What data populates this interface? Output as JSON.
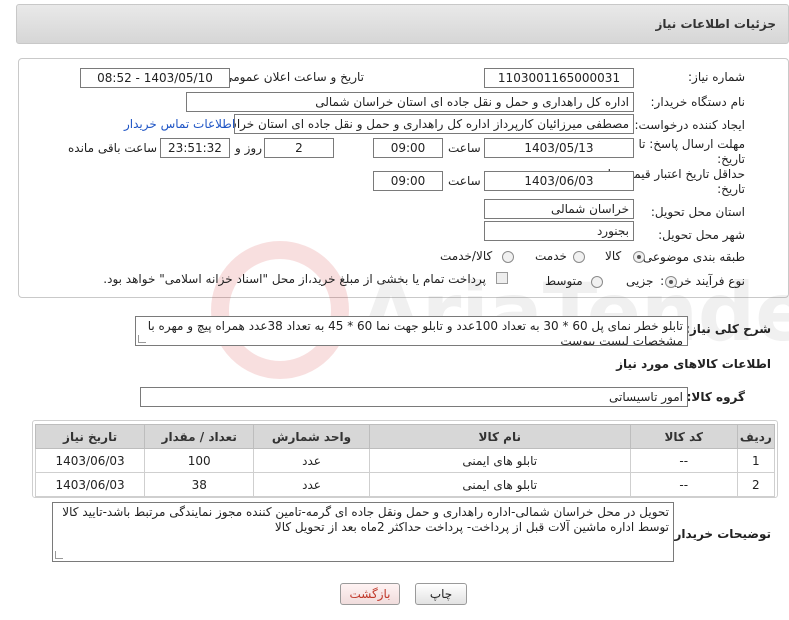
{
  "header": {
    "title": "جزئیات اطلاعات نیاز"
  },
  "form": {
    "need_number": {
      "label": "شماره نیاز:",
      "value": "1103001165000031"
    },
    "announce_datetime": {
      "label": "تاریخ و ساعت اعلان عمومی:",
      "value": "1403/05/10 - 08:52"
    },
    "buyer_org": {
      "label": "نام دستگاه خریدار:",
      "value": "اداره کل راهداری و حمل و نقل جاده ای استان خراسان شمالی"
    },
    "requester": {
      "label": "ایجاد کننده درخواست:",
      "value": "مصطفی میرزائیان کارپرداز اداره کل راهداری و حمل و نقل جاده ای استان خراسان شمالی",
      "contact_link": "اطلاعات تماس خریدار"
    },
    "response_deadline": {
      "label_line1": "مهلت ارسال پاسخ: تا",
      "label_line2": "تاریخ:",
      "date": "1403/05/13",
      "time_label": "ساعت",
      "time": "09:00",
      "days": "2",
      "days_label": "روز و",
      "remaining": "23:51:32",
      "remaining_label": "ساعت باقی مانده"
    },
    "price_validity": {
      "label_line1": "حداقل تاریخ اعتبار قیمت: تا",
      "label_line2": "تاریخ:",
      "date": "1403/06/03",
      "time_label": "ساعت",
      "time": "09:00"
    },
    "delivery_province": {
      "label": "استان محل تحویل:",
      "value": "خراسان شمالی"
    },
    "delivery_city": {
      "label": "شهر محل تحویل:",
      "value": "بجنورد"
    },
    "category": {
      "label": "طبقه بندی موضوعی:",
      "options": [
        "کالا",
        "خدمت",
        "کالا/خدمت"
      ],
      "selected": "کالا"
    },
    "purchase_type": {
      "label": "نوع فرآیند خرید :",
      "options": [
        "جزیی",
        "متوسط"
      ],
      "selected": "جزیی",
      "note": "پرداخت تمام یا بخشی از مبلغ خرید،از محل \"اسناد خزانه اسلامی\" خواهد بود."
    }
  },
  "summary": {
    "label": "شرح کلی نیاز:",
    "value": "تابلو خطر نمای پل 60 * 30 به تعداد 100عدد  و تابلو جهت نما 60 * 45 به تعداد 38عدد  همراه پیچ و مهره با مشخصات لیست پیوست"
  },
  "goods_info": {
    "title": "اطلاعات کالاهای مورد نیاز",
    "group_label": "گروه کالا:",
    "group_value": "امور تاسیساتی"
  },
  "table": {
    "headers": [
      "ردیف",
      "کد کالا",
      "نام کالا",
      "واحد شمارش",
      "تعداد / مقدار",
      "تاریخ نیاز"
    ],
    "rows": [
      [
        "1",
        "--",
        "تابلو های ایمنی",
        "عدد",
        "100",
        "1403/06/03"
      ],
      [
        "2",
        "--",
        "تابلو های ایمنی",
        "عدد",
        "38",
        "1403/06/03"
      ]
    ]
  },
  "buyer_notes": {
    "label": "توضیحات خریدار:",
    "value": "تحویل در محل  خراسان شمالی-اداره راهداری و حمل ونقل جاده ای گرمه-تامین کننده مجوز نمایندگی مرتبط باشد-تایید کالا توسط اداره ماشین آلات قبل از پرداخت- پرداخت حداکثر 2ماه بعد از تحویل کالا"
  },
  "buttons": {
    "print": "چاپ",
    "back": "بازگشت"
  },
  "watermark": "AriaTender.net"
}
